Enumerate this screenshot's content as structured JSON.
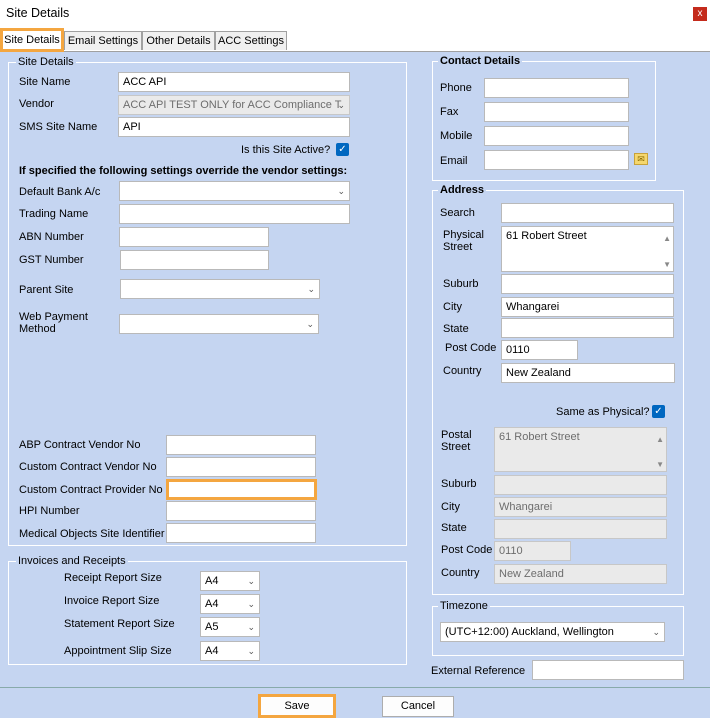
{
  "window": {
    "title": "Site Details",
    "close_glyph": "x"
  },
  "tabs": [
    "Site Details",
    "Email Settings",
    "Other Details",
    "ACC Settings"
  ],
  "site_details": {
    "legend": "Site Details",
    "site_name_label": "Site Name",
    "site_name": "ACC API",
    "vendor_label": "Vendor",
    "vendor": "ACC API TEST ONLY for ACC Compliance T",
    "sms_label": "SMS Site Name",
    "sms": "API",
    "active_label": "Is this Site Active?",
    "active": true,
    "override_heading": "If specified the following settings override the vendor settings:",
    "bank_label": "Default Bank A/c",
    "bank": "",
    "trading_label": "Trading Name",
    "trading": "",
    "abn_label": "ABN Number",
    "abn": "",
    "gst_label": "GST Number",
    "gst": "",
    "parent_label": "Parent Site",
    "parent": "",
    "webpay_label_1": "Web Payment",
    "webpay_label_2": "Method",
    "webpay": "",
    "abp_label": "ABP Contract Vendor No",
    "abp": "",
    "ccv_label": "Custom Contract Vendor No",
    "ccv": "",
    "ccp_label": "Custom Contract Provider No",
    "ccp": "",
    "hpi_label": "HPI Number",
    "hpi": "",
    "mo_label": "Medical Objects Site Identifier",
    "mo": ""
  },
  "invoices": {
    "legend": "Invoices and Receipts",
    "receipt_label": "Receipt Report Size",
    "receipt": "A4",
    "invoice_label": "Invoice Report Size",
    "invoice": "A4",
    "statement_label": "Statement Report Size",
    "statement": "A5",
    "appt_label": "Appointment Slip Size",
    "appt": "A4"
  },
  "contact": {
    "legend": "Contact Details",
    "phone_label": "Phone",
    "phone": "",
    "fax_label": "Fax",
    "fax": "",
    "mobile_label": "Mobile",
    "mobile": "",
    "email_label": "Email",
    "email": "",
    "email_icon": "envelope-icon"
  },
  "address": {
    "legend": "Address",
    "search_label": "Search",
    "search": "",
    "physical_label_1": "Physical",
    "physical_label_2": "Street",
    "physical": "61 Robert Street",
    "suburb_label": "Suburb",
    "suburb": "",
    "city_label": "City",
    "city": "Whangarei",
    "state_label": "State",
    "state": "",
    "postcode_label": "Post Code",
    "postcode": "0110",
    "country_label": "Country",
    "country": "New Zealand",
    "same_label": "Same as Physical?",
    "same": true,
    "postal_label_1": "Postal",
    "postal_label_2": "Street",
    "postal": "61 Robert Street",
    "psuburb_label": "Suburb",
    "psuburb": "",
    "pcity_label": "City",
    "pcity": "Whangarei",
    "pstate_label": "State",
    "pstate": "",
    "ppostcode_label": "Post Code",
    "ppostcode": "0110",
    "pcountry_label": "Country",
    "pcountry": "New Zealand"
  },
  "timezone": {
    "legend": "Timezone",
    "value": "(UTC+12:00) Auckland, Wellington"
  },
  "external_ref": {
    "label": "External Reference",
    "value": ""
  },
  "footer": {
    "save": "Save",
    "cancel": "Cancel"
  },
  "colors": {
    "background": "#c5d5f1",
    "highlight": "#f4a640",
    "checkbox": "#0067c0"
  }
}
